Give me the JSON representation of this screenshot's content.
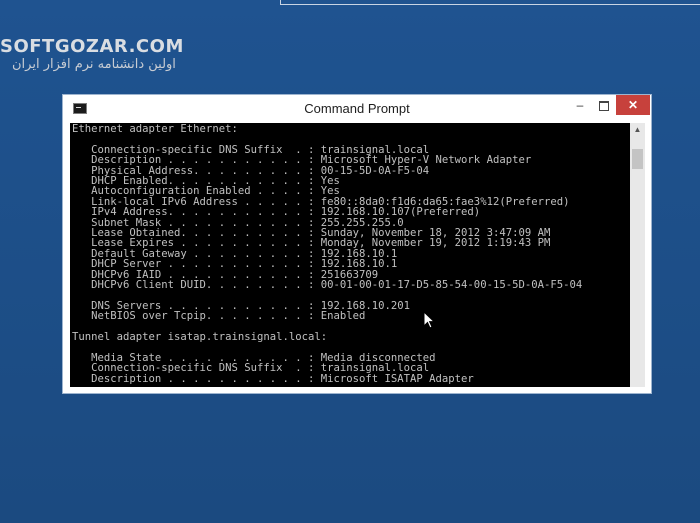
{
  "watermark": {
    "site": "SOFTGOZAR.COM",
    "tagline": "اولین دانشنامه نرم افزار ایران"
  },
  "window": {
    "title": "Command Prompt",
    "minimize_label": "‒",
    "close_label": "✕"
  },
  "console": {
    "lines": [
      "Ethernet adapter Ethernet:",
      "",
      "   Connection-specific DNS Suffix  . : trainsignal.local",
      "   Description . . . . . . . . . . . : Microsoft Hyper-V Network Adapter",
      "   Physical Address. . . . . . . . . : 00-15-5D-0A-F5-04",
      "   DHCP Enabled. . . . . . . . . . . : Yes",
      "   Autoconfiguration Enabled . . . . : Yes",
      "   Link-local IPv6 Address . . . . . : fe80::8da0:f1d6:da65:fae3%12(Preferred)",
      "   IPv4 Address. . . . . . . . . . . : 192.168.10.107(Preferred)",
      "   Subnet Mask . . . . . . . . . . . : 255.255.255.0",
      "   Lease Obtained. . . . . . . . . . : Sunday, November 18, 2012 3:47:09 AM",
      "   Lease Expires . . . . . . . . . . : Monday, November 19, 2012 1:19:43 PM",
      "   Default Gateway . . . . . . . . . : 192.168.10.1",
      "   DHCP Server . . . . . . . . . . . : 192.168.10.1",
      "   DHCPv6 IAID . . . . . . . . . . . : 251663709",
      "   DHCPv6 Client DUID. . . . . . . . : 00-01-00-01-17-D5-85-54-00-15-5D-0A-F5-04",
      "",
      "   DNS Servers . . . . . . . . . . . : 192.168.10.201",
      "   NetBIOS over Tcpip. . . . . . . . : Enabled",
      "",
      "Tunnel adapter isatap.trainsignal.local:",
      "",
      "   Media State . . . . . . . . . . . : Media disconnected",
      "   Connection-specific DNS Suffix  . : trainsignal.local",
      "   Description . . . . . . . . . . . : Microsoft ISATAP Adapter"
    ]
  },
  "colors": {
    "desktop": "#1d4e86",
    "console_bg": "#000000",
    "console_text": "#c0c0c0",
    "close_button": "#c7413c"
  },
  "icons": [
    "console-app-icon",
    "minimize-icon",
    "maximize-icon",
    "close-icon",
    "scroll-up-icon",
    "mouse-pointer-icon"
  ]
}
